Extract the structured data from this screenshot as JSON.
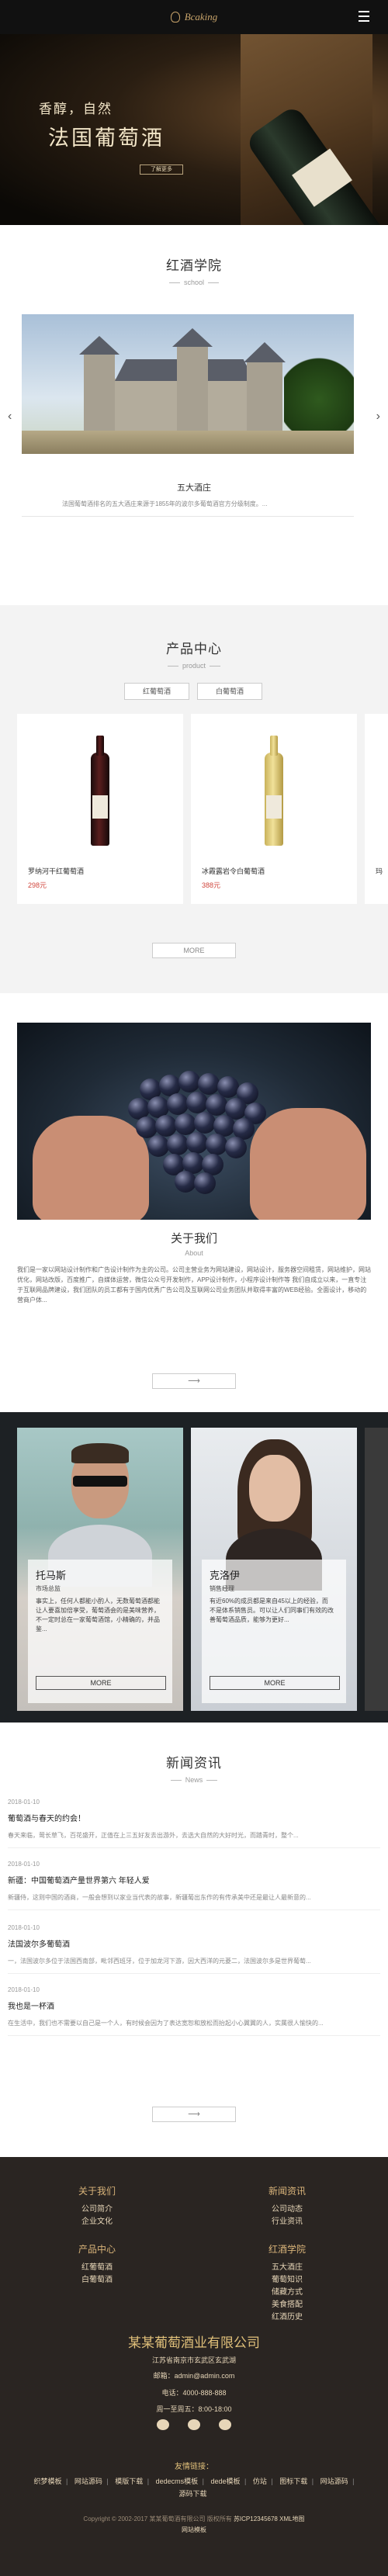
{
  "header": {
    "logo_text": "Bcaking",
    "menu_icon": "hamburger-icon"
  },
  "hero": {
    "line1": "香醇，自然",
    "line2": "法国葡萄酒",
    "button": "了解更多"
  },
  "school": {
    "title": "红酒学院",
    "subtitle": "school",
    "caption": "五大酒庄",
    "description": "法国葡萄酒排名的五大酒庄来源于1855年的波尔多葡萄酒官方分级制度。..."
  },
  "products": {
    "title": "产品中心",
    "subtitle": "product",
    "tabs": [
      "红葡萄酒",
      "白葡萄酒"
    ],
    "items": [
      {
        "name": "罗纳河干红葡萄酒",
        "price": "298元"
      },
      {
        "name": "冰霞露岩令白葡萄酒",
        "price": "388元"
      },
      {
        "name": "玛",
        "price": ""
      }
    ],
    "more": "MORE"
  },
  "about": {
    "title": "关于我们",
    "subtitle": "About",
    "text": "我们是一家以网站设计制作和广告设计制作为主的公司。公司主营业务为网站建设，网站设计，服务器空间租赁，网站维护，网站优化，网站改版，百度推广，自媒体运营，微信公众号开发制作，APP设计制作，小程序设计制作等 我们自成立以来，一直专注于互联网品牌建设，我们团队的员工都有于国内优秀广告公司及互联网公司业务团队并取得丰富的WEB经验。全面设计，移动的营商户体..."
  },
  "team": [
    {
      "name": "托马斯",
      "role": "市场总监",
      "desc": "事实上，任何人都能小酌人，无数葡萄酒都能让人要喜加倍享受，葡萄酒会的是美味营养，不一定时总在一家葡萄酒馆，小精确的，并品鉴..."
    },
    {
      "name": "克洛伊",
      "role": "销售经理",
      "desc": "有近60%的成员都是来自45以上的经验，而不是体系销售员。可以让人们同事们有效的改善葡萄酒品质，能够为更好..."
    }
  ],
  "team_more": "MORE",
  "news": {
    "title": "新闻资讯",
    "subtitle": "News",
    "items": [
      {
        "date": "2018-01-10",
        "title": "葡萄酒与春天的约会！",
        "desc": "春天来临，莺长草飞，百花盛开，正值在上三五好友去出游外，去选大自然的大好时光，而踏青时，整个..."
      },
      {
        "date": "2018-01-10",
        "title": "新疆：中国葡萄酒产量世界第六 年轻人爱",
        "desc": "新疆侍，这则中国的酒商，一般会想到以家业当代表的故事，新疆葡出东作的有传承美中还是最让人最新意的..."
      },
      {
        "date": "2018-01-10",
        "title": "法国波尔多葡萄酒",
        "desc": "一，法国波尔多位于法国西南部，毗邻西班牙，位于加龙河下游，因大西洋的元菱二，法国波尔多是世界葡萄..."
      },
      {
        "date": "2018-01-10",
        "title": "我也是一杯酒",
        "desc": "在生活中，我们也不需要以自己是一个人，有时候会因为了表达宽恕和放松而抬起小心翼翼的人，实属很人愉快的..."
      }
    ]
  },
  "footer": {
    "columns": [
      {
        "title": "关于我们",
        "links": [
          "公司简介",
          "企业文化"
        ]
      },
      {
        "title": "新闻资讯",
        "links": [
          "公司动态",
          "行业资讯"
        ]
      },
      {
        "title": "产品中心",
        "links": [
          "红葡萄酒",
          "白葡萄酒"
        ]
      },
      {
        "title": "红酒学院",
        "links": [
          "五大酒庄",
          "葡萄知识",
          "储藏方式",
          "美食搭配",
          "红酒历史"
        ]
      }
    ],
    "company": "某某葡萄酒业有限公司",
    "address": "江苏省南京市玄武区玄武湖",
    "email": "邮箱：admin@admin.com",
    "phone": "电话：4000-888-888",
    "hours": "周一至周五：8:00-18:00",
    "friend_links_title": "友情链接：",
    "friend_links": [
      "织梦模板",
      "网站源码",
      "模版下载",
      "dedecms模板",
      "dede模板",
      "仿站",
      "图标下载",
      "网站源码",
      "源码下载"
    ],
    "copyright": "Copyright © 2002-2017 某某葡萄酒有限公司 版权所有",
    "icp": "苏ICP12345678",
    "sitemap": "XML地图",
    "template": "网站模板"
  }
}
